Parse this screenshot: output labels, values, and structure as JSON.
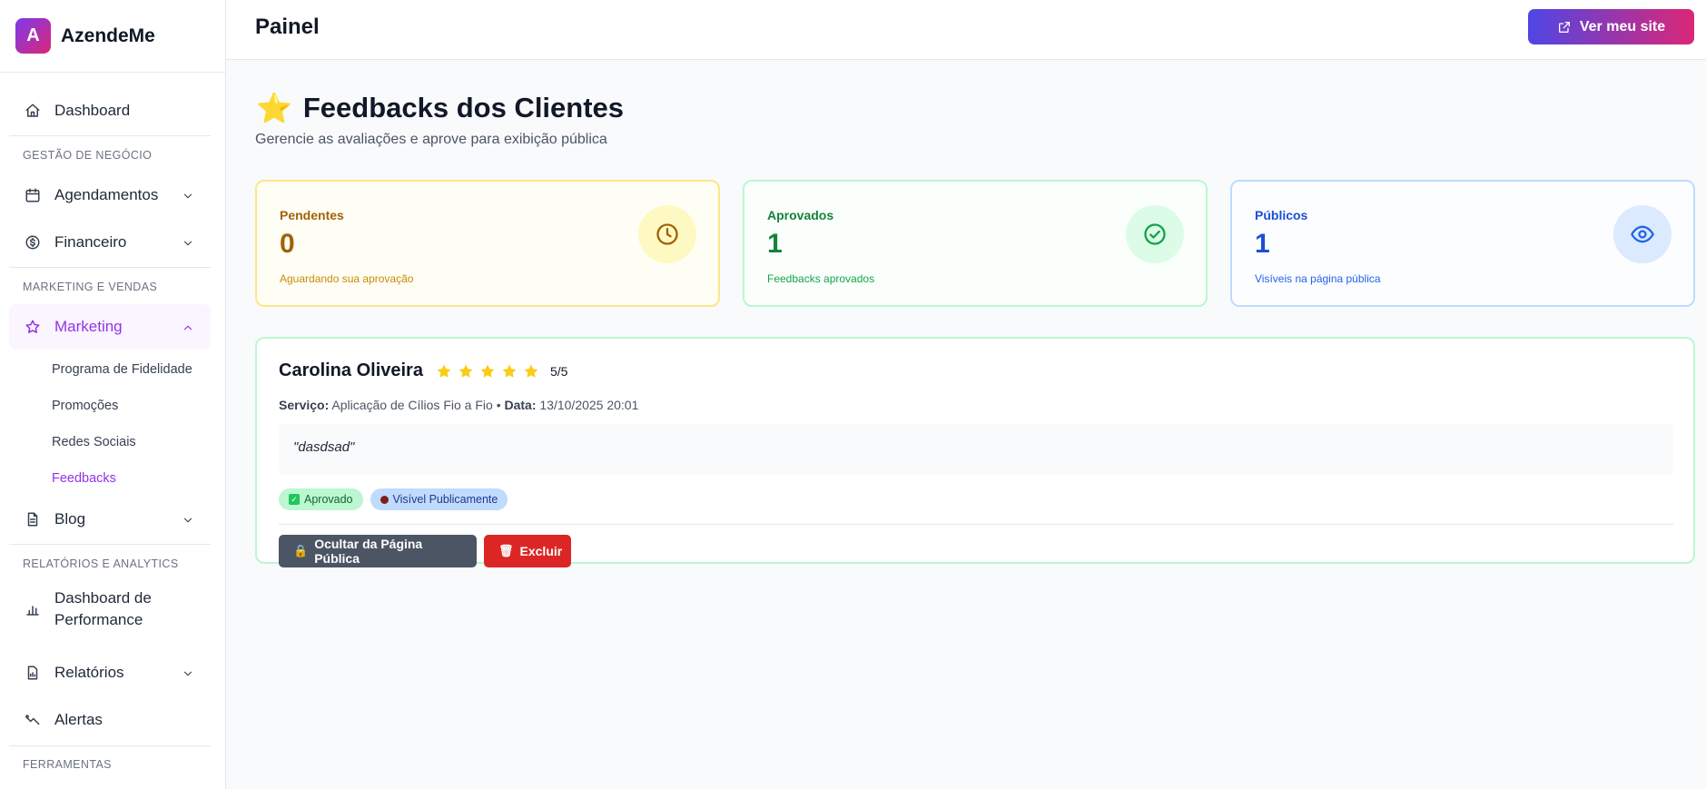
{
  "brand": {
    "logo_letter": "A",
    "name": "AzendeMe"
  },
  "sidebar": {
    "dashboard": "Dashboard",
    "section_business": "GESTÃO DE NEGÓCIO",
    "agendamentos": "Agendamentos",
    "financeiro": "Financeiro",
    "section_marketing": "MARKETING E VENDAS",
    "marketing": "Marketing",
    "marketing_sub": [
      "Programa de Fidelidade",
      "Promoções",
      "Redes Sociais",
      "Feedbacks"
    ],
    "blog": "Blog",
    "section_reports": "RELATÓRIOS E ANALYTICS",
    "performance_line1": "Dashboard de",
    "performance_line2": "Performance",
    "relatorios": "Relatórios",
    "alertas": "Alertas",
    "section_tools": "FERRAMENTAS"
  },
  "header": {
    "title": "Painel",
    "site_button": "Ver meu site"
  },
  "page": {
    "title": "Feedbacks dos Clientes",
    "subtitle": "Gerencie as avaliações e aprove para exibição pública"
  },
  "stats": {
    "pending": {
      "label": "Pendentes",
      "value": "0",
      "desc": "Aguardando sua aprovação",
      "icon": "clock-icon"
    },
    "approved": {
      "label": "Aprovados",
      "value": "1",
      "desc": "Feedbacks aprovados",
      "icon": "check-circle-icon"
    },
    "public": {
      "label": "Públicos",
      "value": "1",
      "desc": "Visíveis na página pública",
      "icon": "eye-icon"
    }
  },
  "feedback": {
    "name": "Carolina Oliveira",
    "stars": 5,
    "rating_text": "5/5",
    "service_label": "Serviço:",
    "service_value": "Aplicação de Cílios Fio a Fio",
    "sep": "•",
    "date_label": "Data:",
    "date_value": "13/10/2025 20:01",
    "comment": "\"dasdsad\"",
    "badge_approved": "Aprovado",
    "badge_public": "Visível Publicamente",
    "hide_button": "Ocultar da Página Pública",
    "delete_button": "Excluir"
  },
  "colors": {
    "accent_purple": "#9333ea",
    "pending": "#a16207",
    "approved": "#15803d",
    "public": "#1d4ed8",
    "danger": "#dc2626"
  }
}
